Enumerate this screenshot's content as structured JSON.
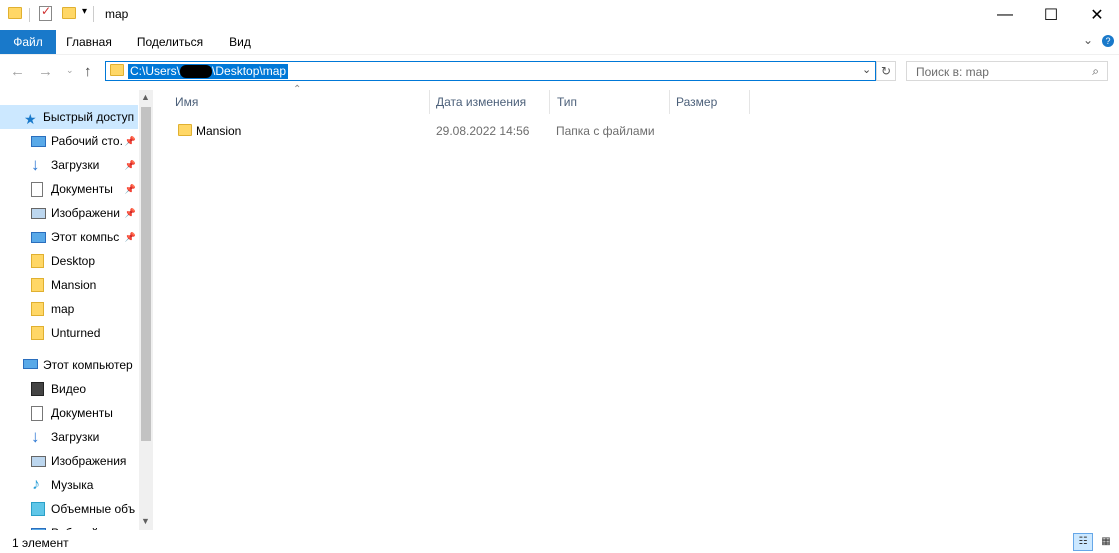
{
  "window": {
    "title": "map"
  },
  "ribbon": {
    "tabs": [
      "Файл",
      "Главная",
      "Поделиться",
      "Вид"
    ]
  },
  "address": {
    "path": "C:\\Users\\",
    "path_tail": "\\Desktop\\map"
  },
  "search": {
    "placeholder": "Поиск в: map"
  },
  "nav": {
    "quick_access": {
      "label": "Быстрый доступ",
      "items": [
        {
          "label": "Рабочий сто.",
          "icon": "desktop-icon",
          "pinned": true
        },
        {
          "label": "Загрузки",
          "icon": "download-icon",
          "pinned": true
        },
        {
          "label": "Документы",
          "icon": "documents-icon",
          "pinned": true
        },
        {
          "label": "Изображени",
          "icon": "pictures-icon",
          "pinned": true
        },
        {
          "label": "Этот компьс",
          "icon": "computer-icon",
          "pinned": true
        },
        {
          "label": "Desktop",
          "icon": "folder-icon",
          "pinned": false
        },
        {
          "label": "Mansion",
          "icon": "folder-icon",
          "pinned": false
        },
        {
          "label": "map",
          "icon": "folder-icon",
          "pinned": false
        },
        {
          "label": "Unturned",
          "icon": "folder-icon",
          "pinned": false
        }
      ]
    },
    "this_pc": {
      "label": "Этот компьютер",
      "items": [
        {
          "label": "Видео",
          "icon": "video-icon"
        },
        {
          "label": "Документы",
          "icon": "documents-icon"
        },
        {
          "label": "Загрузки",
          "icon": "download-icon"
        },
        {
          "label": "Изображения",
          "icon": "pictures-icon"
        },
        {
          "label": "Музыка",
          "icon": "music-icon"
        },
        {
          "label": "Объемные объ",
          "icon": "3d-objects-icon"
        },
        {
          "label": "Рабочий",
          "icon": "desktop-icon"
        }
      ]
    }
  },
  "columns": {
    "name": "Имя",
    "date": "Дата изменения",
    "type": "Тип",
    "size": "Размер"
  },
  "files": [
    {
      "name": "Mansion",
      "date": "29.08.2022 14:56",
      "type": "Папка с файлами",
      "size": ""
    }
  ],
  "status": {
    "count": "1 элемент"
  },
  "colors": {
    "accent": "#1979ca",
    "selection": "#cce8ff",
    "folder": "#ffd766"
  }
}
